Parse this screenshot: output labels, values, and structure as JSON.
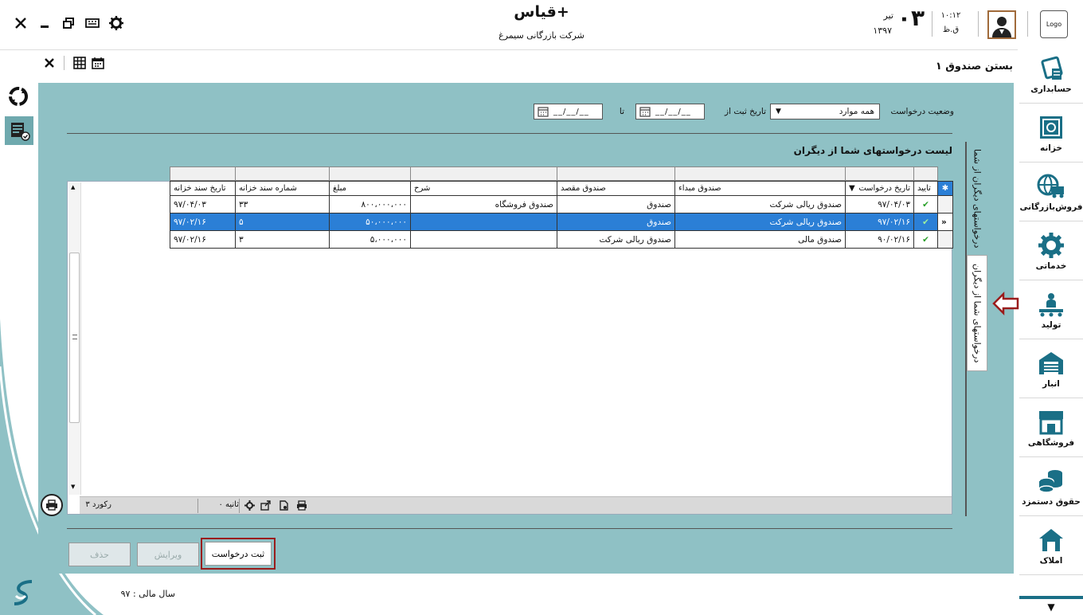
{
  "header": {
    "app_title": "قیاس+",
    "company": "شرکت بازرگانی سیمرغ",
    "time": "۱۰:۱۲",
    "meridiem": "ق.ظ",
    "day": "۰۳",
    "month": "تیر",
    "year": "۱۳۹۷",
    "logo": "Logo"
  },
  "page": {
    "title": "بستن صندوق ۱"
  },
  "filters": {
    "status_label": "وضعیت درخواست",
    "status_value": "همه موارد",
    "date_from_label": "تاریخ ثبت از",
    "date_placeholder": "__/__/__",
    "date_to_label": "تا"
  },
  "list_title": "لیست درخواستهای شما از دیگران",
  "grid": {
    "headers": {
      "approve": "تایید",
      "request_date": "تاریخ درخواست",
      "source_fund": "صندوق مبداء",
      "dest_fund": "صندوق مقصد",
      "desc": "شرح",
      "amount": "مبلغ",
      "treasury_no": "شماره سند خزانه",
      "treasury_date": "تاریخ سند خزانه"
    },
    "rows": [
      {
        "date": "۹۷/۰۴/۰۳",
        "source": "صندوق ریالی شرکت",
        "dest": "صندوق",
        "desc": "صندوق فروشگاه",
        "amount": "۸۰۰،۰۰۰،۰۰۰",
        "tno": "۳۳",
        "tdate": "۹۷/۰۴/۰۳"
      },
      {
        "date": "۹۷/۰۲/۱۶",
        "source": "صندوق ریالی شرکت",
        "dest": "صندوق",
        "desc": "",
        "amount": "۵۰،۰۰۰،۰۰۰",
        "tno": "۵",
        "tdate": "۹۷/۰۲/۱۶"
      },
      {
        "date": "۹۰/۰۲/۱۶",
        "source": "صندوق مالی",
        "dest": "صندوق ریالی شرکت",
        "desc": "",
        "amount": "۵،۰۰۰،۰۰۰",
        "tno": "۳",
        "tdate": "۹۷/۰۲/۱۶"
      }
    ]
  },
  "status_bar": {
    "records": "۳ رکورد",
    "seconds": "۰ ثانیه"
  },
  "buttons": {
    "submit": "ثبت درخواست",
    "edit": "ویرایش",
    "delete": "حذف"
  },
  "side_tabs": {
    "tab1": "درخواستهای دیگران از شما",
    "tab2": "درخواستهای شما از دیگران"
  },
  "sidebar": {
    "items": [
      {
        "label": "حسابداری"
      },
      {
        "label": "خزانه"
      },
      {
        "label": "فروش‌بازرگانی"
      },
      {
        "label": "خدماتی"
      },
      {
        "label": "تولید"
      },
      {
        "label": "انبار"
      },
      {
        "label": "فروشگاهی"
      },
      {
        "label": "حقوق دستمزد"
      },
      {
        "label": "املاک"
      }
    ]
  },
  "footer": {
    "fiscal_year": "سال مالی : ۹۷"
  },
  "colors": {
    "panel": "#8fc1c5",
    "accent": "#1a6f86",
    "selection": "#2b7fd6",
    "highlight": "#9a1c1c"
  }
}
